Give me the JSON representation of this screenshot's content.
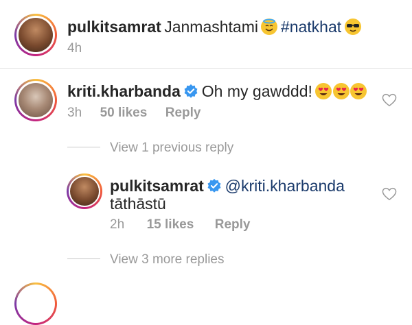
{
  "post_caption": {
    "username": "pulkitsamrat",
    "text": "Janmashtami",
    "hashtag": "#natkhat",
    "time": "4h",
    "emojis": [
      "smiling-face-with-halo",
      "smiling-face-with-sunglasses"
    ]
  },
  "comment": {
    "username": "kriti.kharbanda",
    "verified": true,
    "text": "Oh my gawddd!",
    "emojis": [
      "heart-eyes",
      "heart-eyes",
      "heart-eyes"
    ],
    "time": "3h",
    "likes": "50 likes",
    "reply_label": "Reply"
  },
  "view_previous": "View 1 previous reply",
  "reply": {
    "username": "pulkitsamrat",
    "verified": true,
    "mention": "@kriti.kharbanda",
    "text": "tāthāstū",
    "time": "2h",
    "likes": "15 likes",
    "reply_label": "Reply"
  },
  "view_more": "View 3 more replies",
  "colors": {
    "link": "#1a3a6b",
    "verified": "#3897f0",
    "meta": "#999999",
    "text": "#262626"
  }
}
